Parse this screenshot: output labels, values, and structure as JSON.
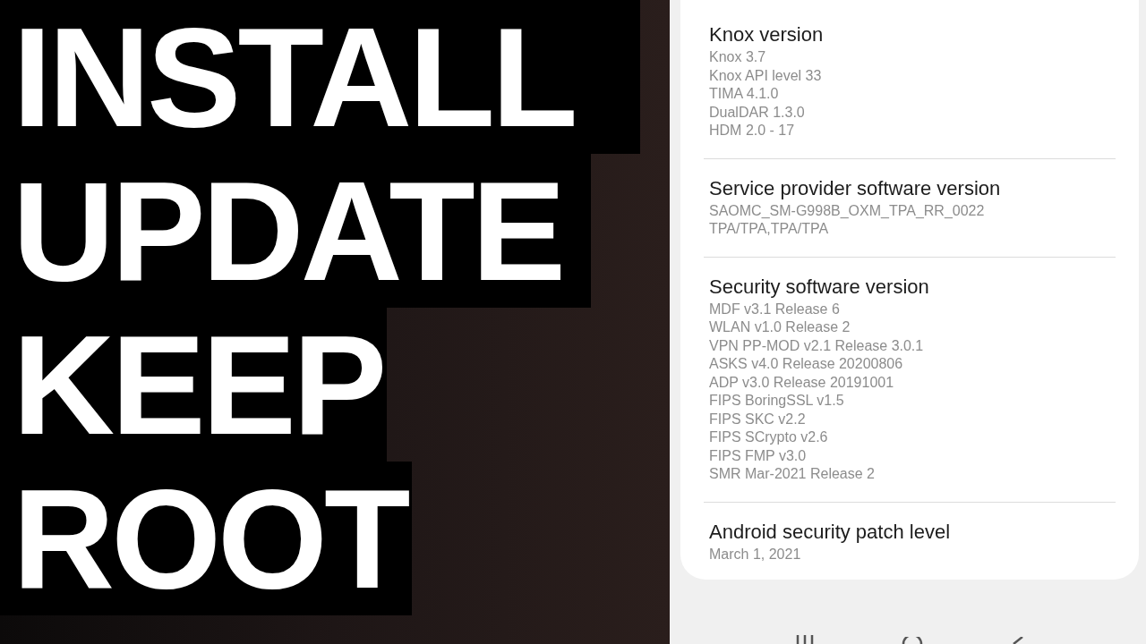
{
  "title_lines": [
    "INSTALL",
    "UPDATE",
    "KEEP",
    "ROOT"
  ],
  "sections": [
    {
      "title": "Knox version",
      "values": [
        "Knox 3.7",
        "Knox API level 33",
        "TIMA 4.1.0",
        "DualDAR 1.3.0",
        "HDM 2.0 - 17"
      ]
    },
    {
      "title": "Service provider software version",
      "values": [
        "SAOMC_SM-G998B_OXM_TPA_RR_0022",
        "TPA/TPA,TPA/TPA"
      ]
    },
    {
      "title": "Security software version",
      "values": [
        "MDF v3.1 Release 6",
        "WLAN v1.0 Release 2",
        "VPN PP-MOD v2.1 Release 3.0.1",
        "ASKS v4.0 Release 20200806",
        "ADP v3.0 Release 20191001",
        "FIPS BoringSSL v1.5",
        "FIPS SKC v2.2",
        "FIPS SCrypto v2.6",
        "FIPS FMP v3.0",
        "SMR Mar-2021 Release 2"
      ]
    },
    {
      "title": "Android security patch level",
      "values": [
        "March 1, 2021"
      ]
    }
  ]
}
